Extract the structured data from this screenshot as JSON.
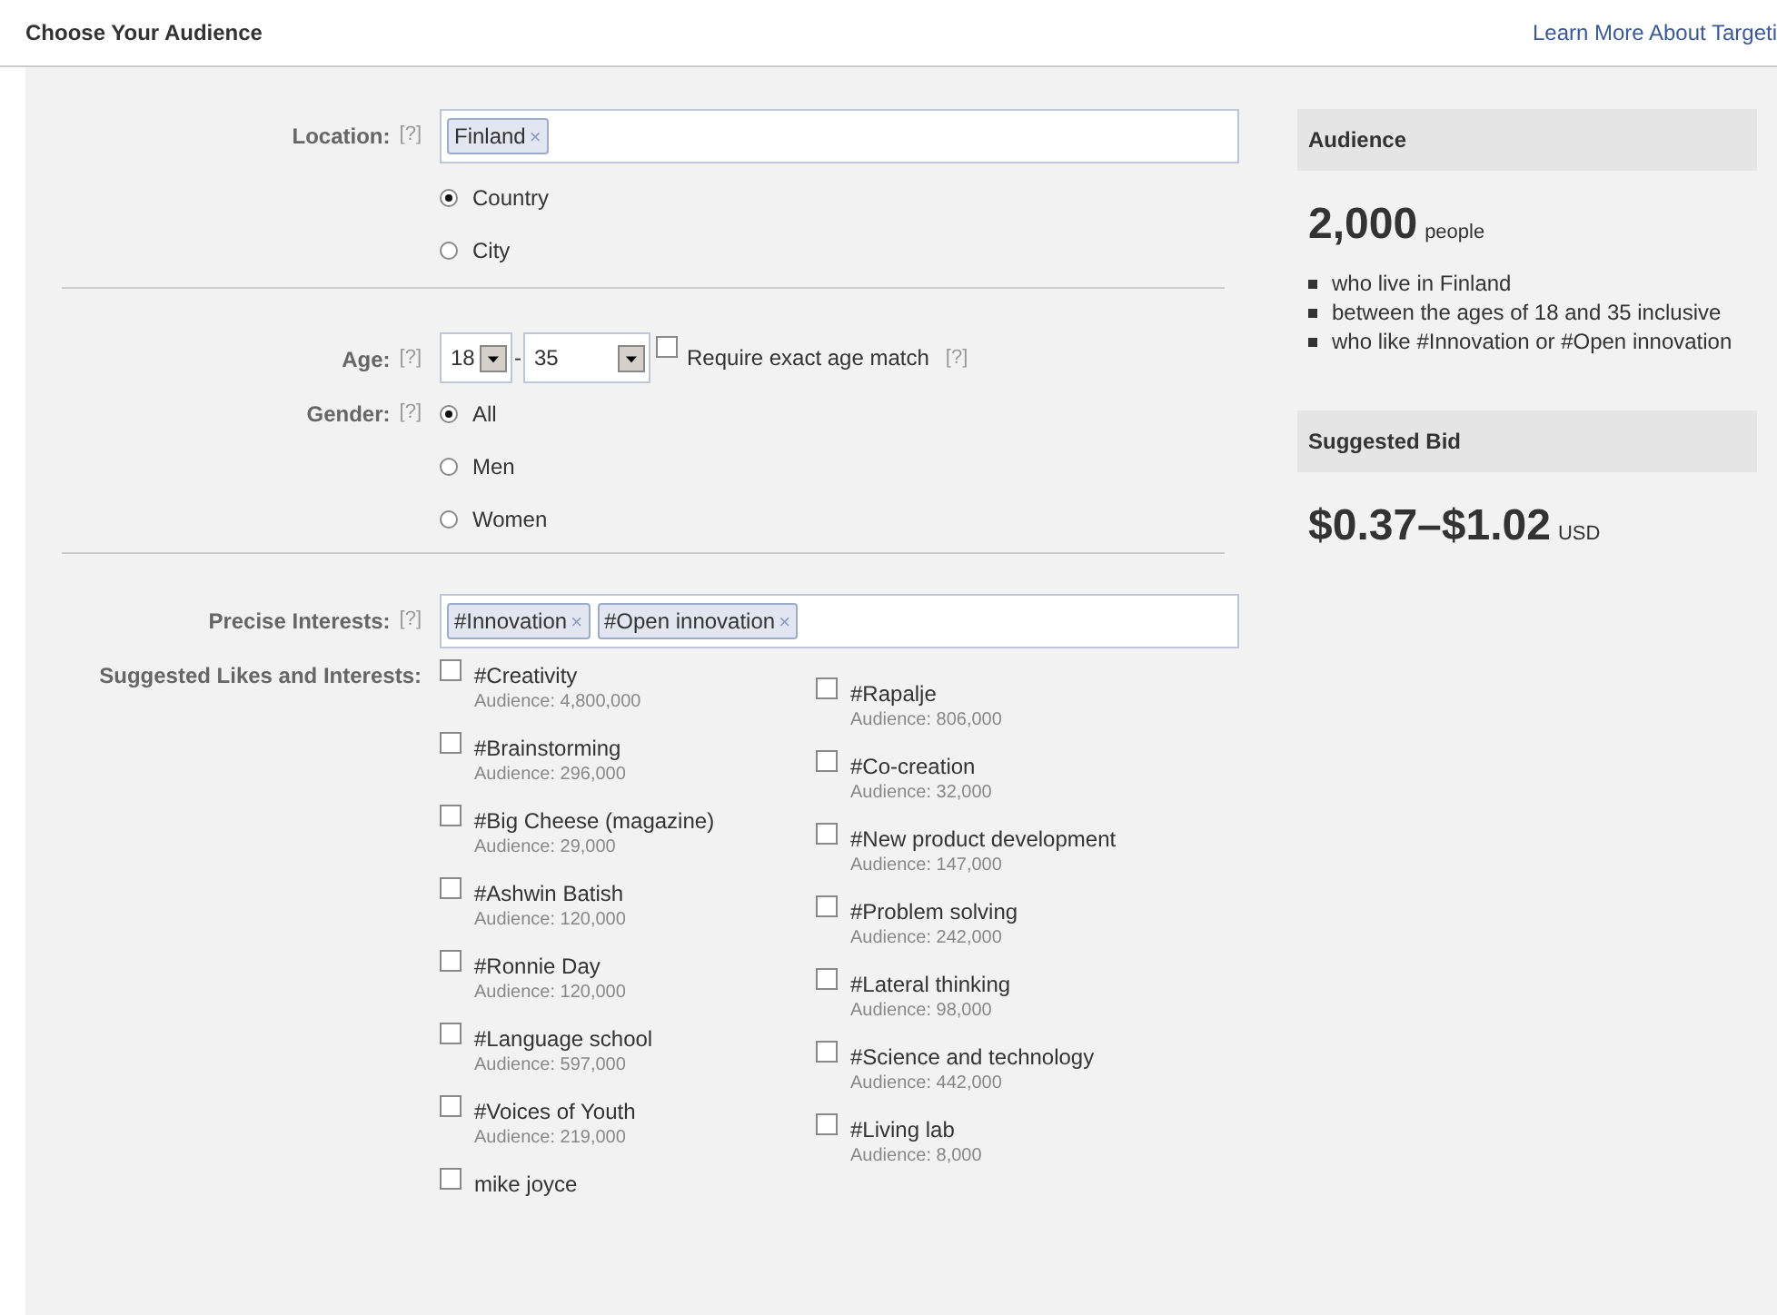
{
  "header": {
    "title": "Choose Your Audience",
    "link": "Learn More About Targeti"
  },
  "location": {
    "label": "Location:",
    "help": "[?]",
    "tokens": [
      {
        "text": "Finland",
        "remove": "×"
      }
    ],
    "options": [
      {
        "label": "Country",
        "selected": true
      },
      {
        "label": "City",
        "selected": false
      }
    ]
  },
  "age": {
    "label": "Age:",
    "help": "[?]",
    "from": "18",
    "separator": "-",
    "to": "35",
    "exact": {
      "label": "Require exact age match",
      "checked": false,
      "help": "[?]"
    }
  },
  "gender": {
    "label": "Gender:",
    "help": "[?]",
    "options": [
      {
        "label": "All",
        "selected": true
      },
      {
        "label": "Men",
        "selected": false
      },
      {
        "label": "Women",
        "selected": false
      }
    ]
  },
  "interests": {
    "label": "Precise Interests:",
    "help": "[?]",
    "tokens": [
      {
        "text": "#Innovation",
        "remove": "×"
      },
      {
        "text": "#Open innovation",
        "remove": "×"
      }
    ]
  },
  "suggested": {
    "label": "Suggested Likes and Interests:",
    "columns": [
      [
        {
          "name": "#Creativity",
          "audience": "Audience: 4,800,000",
          "checked": false
        },
        {
          "name": "#Brainstorming",
          "audience": "Audience: 296,000",
          "checked": false
        },
        {
          "name": "#Big Cheese (magazine)",
          "audience": "Audience: 29,000",
          "checked": false
        },
        {
          "name": "#Ashwin Batish",
          "audience": "Audience: 120,000",
          "checked": false
        },
        {
          "name": "#Ronnie Day",
          "audience": "Audience: 120,000",
          "checked": false
        },
        {
          "name": "#Language school",
          "audience": "Audience: 597,000",
          "checked": false
        },
        {
          "name": "#Voices of Youth",
          "audience": "Audience: 219,000",
          "checked": false
        },
        {
          "name": "mike joyce",
          "checked": false
        }
      ],
      [
        {
          "name": "#Rapalje",
          "audience": "Audience: 806,000",
          "checked": false
        },
        {
          "name": "#Co-creation",
          "audience": "Audience: 32,000",
          "checked": false
        },
        {
          "name": "#New product development",
          "audience": "Audience: 147,000",
          "checked": false
        },
        {
          "name": "#Problem solving",
          "audience": "Audience: 242,000",
          "checked": false
        },
        {
          "name": "#Lateral thinking",
          "audience": "Audience: 98,000",
          "checked": false
        },
        {
          "name": "#Science and technology",
          "audience": "Audience: 442,000",
          "checked": false
        },
        {
          "name": "#Living lab",
          "audience": "Audience: 8,000",
          "checked": false
        }
      ]
    ]
  },
  "sidebar": {
    "audience": {
      "title": "Audience",
      "count": "2,000",
      "unit": "people",
      "bullets": [
        "who live in Finland",
        "between the ages of 18 and 35 inclusive",
        "who like #Innovation or #Open innovation"
      ]
    },
    "bid": {
      "title": "Suggested Bid",
      "amount": "$0.37–$1.02",
      "unit": "USD"
    }
  }
}
